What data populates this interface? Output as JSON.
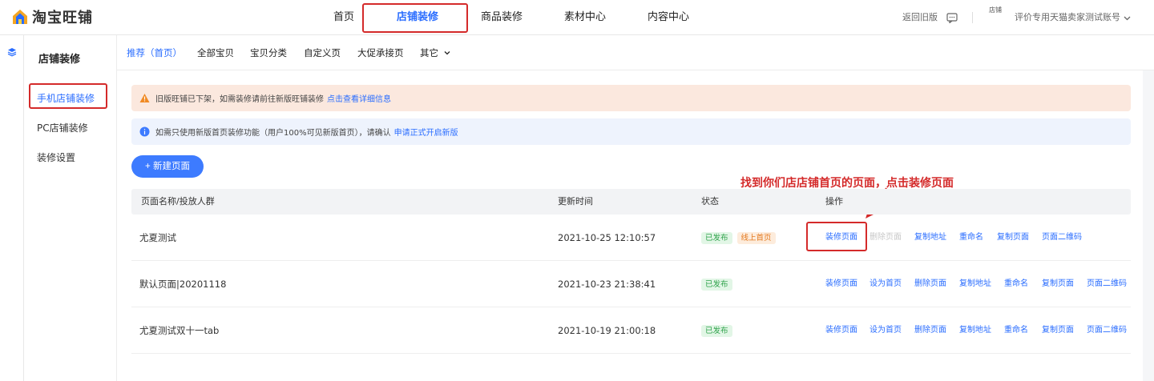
{
  "topnav": {
    "logo_text": "淘宝旺铺",
    "items": [
      "首页",
      "店铺装修",
      "商品装修",
      "素材中心",
      "内容中心"
    ],
    "active_index": 1,
    "back_old": "返回旧版",
    "avatar_alt": "店铺",
    "account": "评价专用天猫卖家测试账号"
  },
  "sidebar": {
    "title": "店铺装修",
    "items": [
      "手机店铺装修",
      "PC店铺装修",
      "装修设置"
    ],
    "active_index": 0
  },
  "subtabs": {
    "items": [
      "推荐（首页）",
      "全部宝贝",
      "宝贝分类",
      "自定义页",
      "大促承接页",
      "其它"
    ],
    "active_index": 0
  },
  "alerts": {
    "warn_text": "旧版旺铺已下架，如需装修请前往新版旺铺装修",
    "warn_link": "点击查看详细信息",
    "info_text": "如需只使用新版首页装修功能（用户100%可见新版首页），请确认",
    "info_link": "申请正式开启新版"
  },
  "new_page_button": "+ 新建页面",
  "annotation": "找到你们店店铺首页的页面，点击装修页面",
  "table": {
    "headers": [
      "页面名称/投放人群",
      "更新时间",
      "状态",
      "操作"
    ],
    "rows": [
      {
        "name": "尤夏测试",
        "time": "2021-10-25 12:10:57",
        "badges": [
          "已发布",
          "线上首页"
        ],
        "ops": [
          "装修页面",
          "删除页面",
          "复制地址",
          "重命名",
          "复制页面",
          "页面二维码"
        ]
      },
      {
        "name": "默认页面|20201118",
        "time": "2021-10-23 21:38:41",
        "badges": [
          "已发布"
        ],
        "ops": [
          "装修页面",
          "设为首页",
          "删除页面",
          "复制地址",
          "重命名",
          "复制页面",
          "页面二维码"
        ]
      },
      {
        "name": "尤夏测试双十一tab",
        "time": "2021-10-19 21:00:18",
        "badges": [
          "已发布"
        ],
        "ops": [
          "装修页面",
          "设为首页",
          "删除页面",
          "复制地址",
          "重命名",
          "复制页面",
          "页面二维码"
        ]
      }
    ]
  },
  "colors": {
    "accent": "#2a6dff",
    "highlight_red": "#d42a2a",
    "published_green": "#2ea24a",
    "homepage_orange": "#e47b22"
  },
  "icons": {
    "logo": "house-logo-icon",
    "feedback": "message-icon",
    "dropdown": "chevron-down-icon",
    "rail": "layers-icon",
    "warn": "warning-icon",
    "info": "info-icon"
  }
}
